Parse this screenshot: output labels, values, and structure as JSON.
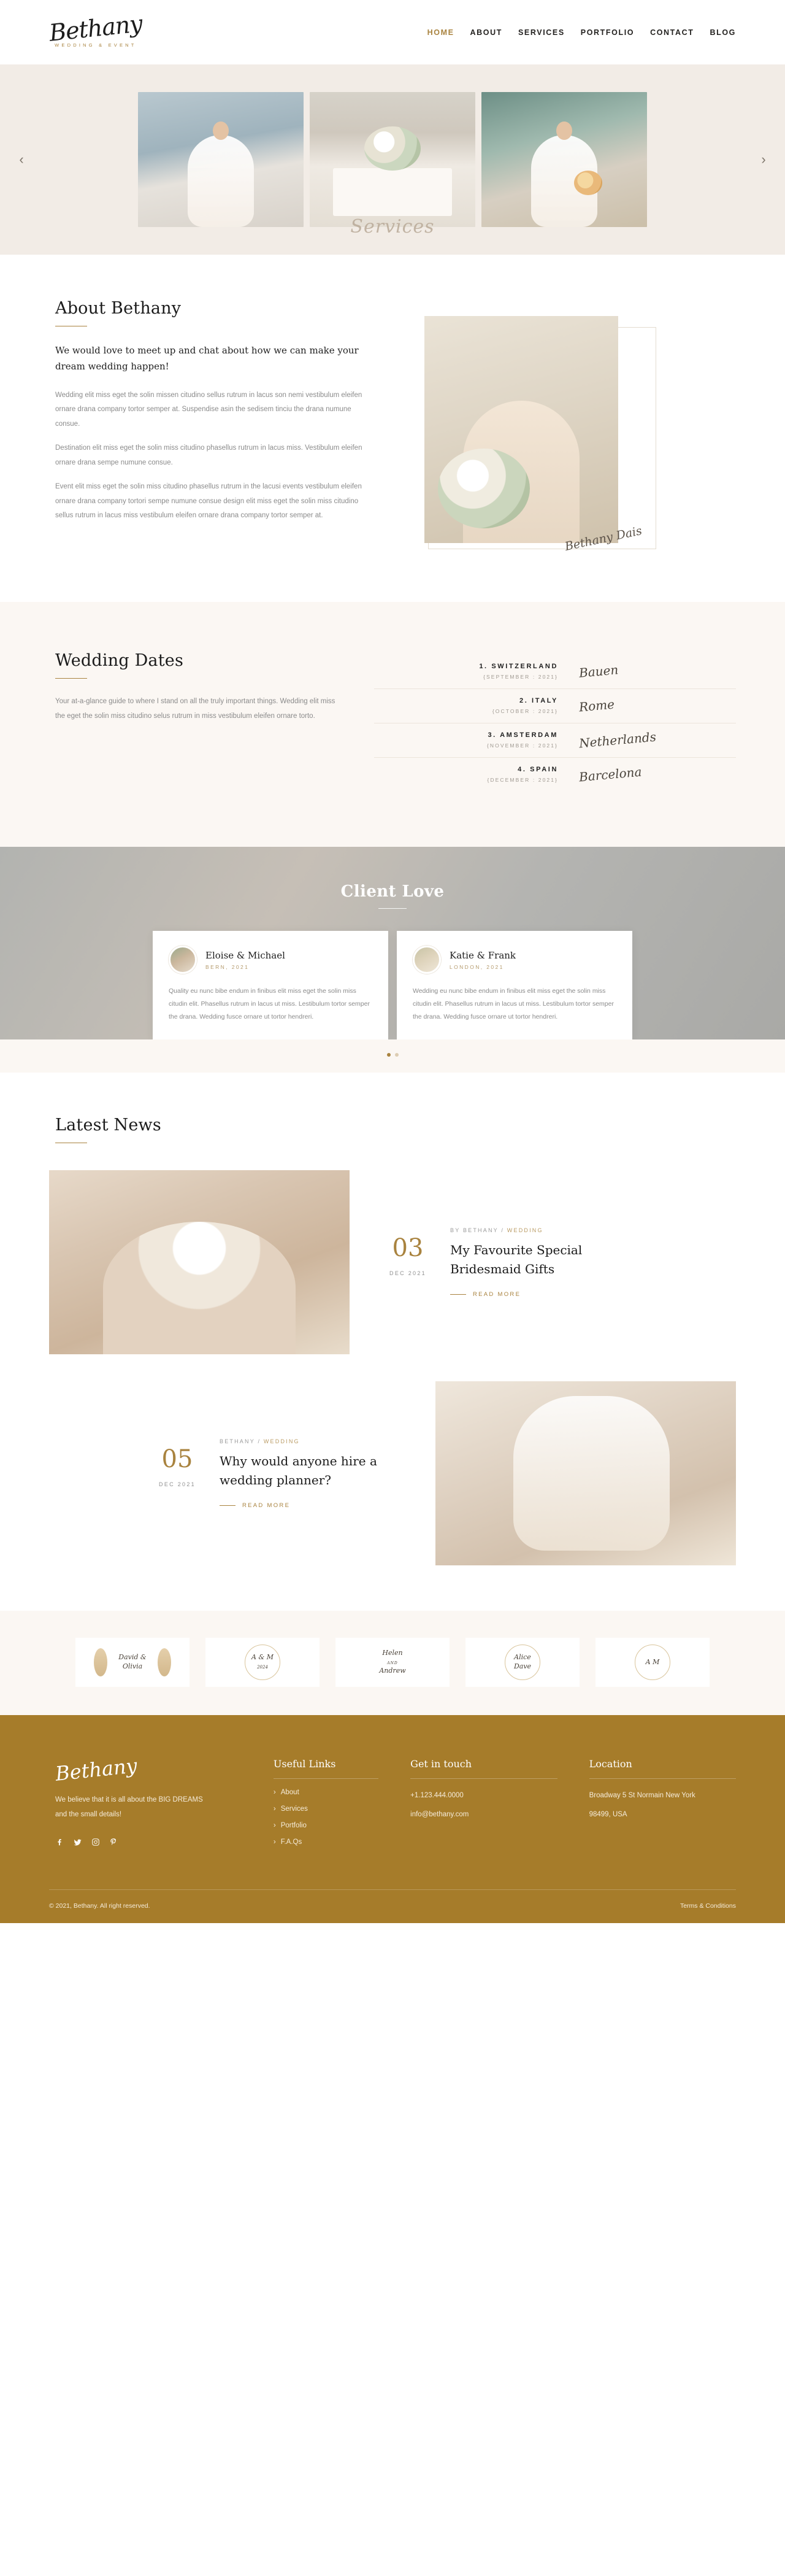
{
  "header": {
    "brand_name": "Bethany",
    "brand_sub": "WEDDING & EVENT",
    "nav": [
      {
        "label": "HOME",
        "active": true
      },
      {
        "label": "ABOUT",
        "active": false
      },
      {
        "label": "SERVICES",
        "active": false
      },
      {
        "label": "PORTFOLIO",
        "active": false
      },
      {
        "label": "CONTACT",
        "active": false
      },
      {
        "label": "BLOG",
        "active": false
      }
    ]
  },
  "hero": {
    "script_text": "Services",
    "prev_icon": "chevron-left-icon",
    "next_icon": "chevron-right-icon",
    "prev_glyph": "‹",
    "next_glyph": "›",
    "slides": [
      {
        "alt": "bride-on-lakeside-dock"
      },
      {
        "alt": "reception-table-with-flowers"
      },
      {
        "alt": "bride-with-bouquet-by-lake"
      }
    ]
  },
  "about": {
    "title": "About Bethany",
    "lead": "We would love to meet up and chat about how we can make your dream wedding happen!",
    "paragraphs": [
      "Wedding elit miss eget the solin missen citudino sellus rutrum in lacus son nemi vestibulum eleifen ornare drana company tortor semper at. Suspendise asin the sedisem tinciu the drana numune consue.",
      "Destination elit miss eget the solin miss citudino phasellus rutrum in lacus miss. Vestibulum eleifen ornare drana sempe numune consue.",
      "Event elit miss eget the solin miss citudino phasellus rutrum in the lacusi events vestibulum eleifen ornare drana company tortori sempe numune consue design elit miss eget the solin miss citudino sellus rutrum in lacus miss vestibulum eleifen ornare drana company tortor semper at."
    ],
    "signature": "Bethany Dais"
  },
  "dates": {
    "title": "Wedding Dates",
    "intro": "Your at-a-glance guide to where I stand on all the truly important things. Wedding elit miss the eget the solin miss citudino selus rutrum in miss vestibulum eleifen ornare torto.",
    "rows": [
      {
        "country": "1. SWITZERLAND",
        "when": "{SEPTEMBER : 2021}",
        "city": "Bauen"
      },
      {
        "country": "2. ITALY",
        "when": "{OCTOBER : 2021}",
        "city": "Rome"
      },
      {
        "country": "3. AMSTERDAM",
        "when": "{NOVEMBER : 2021}",
        "city": "Netherlands"
      },
      {
        "country": "4. SPAIN",
        "when": "{DECEMBER : 2021}",
        "city": "Barcelona"
      }
    ]
  },
  "testimonials": {
    "title": "Client Love",
    "cards": [
      {
        "name": "Eloise & Michael",
        "place": "BERN, 2021",
        "quote": "Quality eu nunc bibe endum in finibus elit miss eget the solin miss citudin elit. Phasellus rutrum in lacus ut miss. Lestibulum tortor semper the drana. Wedding fusce ornare ut tortor hendreri."
      },
      {
        "name": "Katie & Frank",
        "place": "LONDON, 2021",
        "quote": "Wedding eu nunc bibe endum in finibus elit miss eget the solin miss citudin elit. Phasellus rutrum in lacus ut miss. Lestibulum tortor semper the drana. Wedding fusce ornare ut tortor hendreri."
      }
    ],
    "dots": [
      {
        "active": true
      },
      {
        "active": false
      }
    ]
  },
  "news": {
    "title": "Latest News",
    "posts": [
      {
        "day": "03",
        "month": "DEC 2021",
        "author": "BY BETHANY /",
        "category": "WEDDING",
        "title": "My Favourite Special Bridesmaid Gifts",
        "read_more": "READ MORE"
      },
      {
        "day": "05",
        "month": "DEC 2021",
        "author": "BETHANY /",
        "category": "WEDDING",
        "title": "Why would anyone hire a wedding planner?",
        "read_more": "READ MORE"
      }
    ]
  },
  "partners": [
    {
      "line1": "David &",
      "line2": "Olivia",
      "sub": ""
    },
    {
      "line1": "A & M",
      "line2": "",
      "sub": "2024"
    },
    {
      "line1": "Helen",
      "line2": "AND",
      "sub": "Andrew"
    },
    {
      "line1": "Alice",
      "line2": "Dave",
      "sub": ""
    },
    {
      "line1": "A M",
      "line2": "",
      "sub": ""
    }
  ],
  "footer": {
    "brand": "Bethany",
    "tagline": "We believe that it is all about the BIG DREAMS and the small details!",
    "social": [
      {
        "name": "facebook-icon",
        "glyph": "f"
      },
      {
        "name": "twitter-icon",
        "glyph": "ᵥ"
      },
      {
        "name": "instagram-icon",
        "glyph": "▢"
      },
      {
        "name": "pinterest-icon",
        "glyph": "P"
      }
    ],
    "links_title": "Useful Links",
    "links": [
      "About",
      "Services",
      "Portfolio",
      "F.A.Qs"
    ],
    "contact_title": "Get in touch",
    "phone": "+1.123.444.0000",
    "email": "info@bethany.com",
    "location_title": "Location",
    "address_line1": "Broadway 5 St Normain New York",
    "address_line2": "98499, USA",
    "copyright": "© 2021, Bethany. All right reserved.",
    "terms": "Terms & Conditions"
  },
  "colors": {
    "accent": "#a9833f",
    "footer_bg": "#a67c2a",
    "cream": "#fbf7f3",
    "hero_bg": "#f2ece6"
  }
}
